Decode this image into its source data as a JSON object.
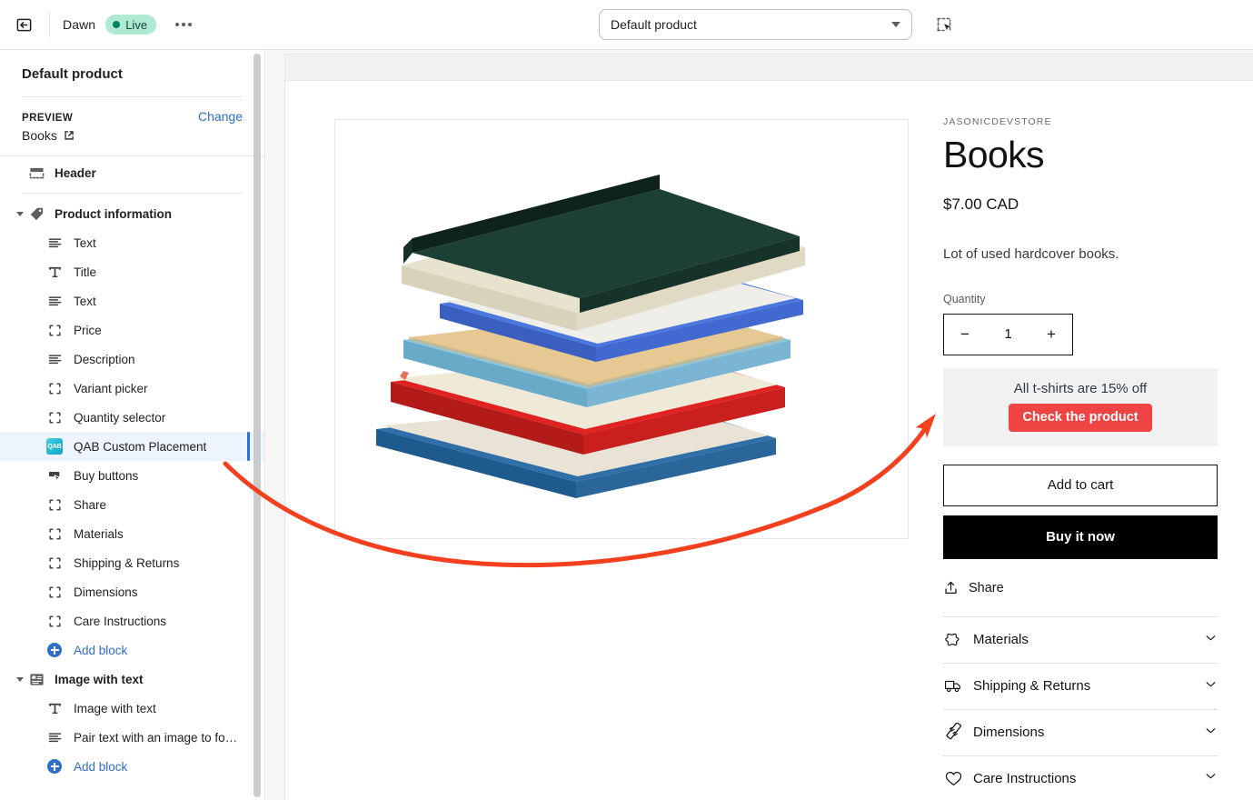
{
  "topbar": {
    "back_icon": "back-arrow-icon",
    "theme_name": "Dawn",
    "status_badge": "Live",
    "more_icon": "ellipsis-icon",
    "template_select": "Default product",
    "inspect_icon": "inspector-select-icon"
  },
  "sidebar": {
    "panel_title": "Default product",
    "preview_label": "PREVIEW",
    "change_link": "Change",
    "preview_value": "Books",
    "external_icon": "external-link-icon",
    "sections": [
      {
        "name": "Header",
        "icon": "header-block-icon",
        "collapsible": false,
        "blocks": []
      },
      {
        "name": "Product information",
        "icon": "tag-icon",
        "collapsible": true,
        "blocks": [
          {
            "label": "Text",
            "icon": "text-lines-icon",
            "selected": false
          },
          {
            "label": "Title",
            "icon": "text-t-icon",
            "selected": false
          },
          {
            "label": "Text",
            "icon": "text-lines-icon",
            "selected": false
          },
          {
            "label": "Price",
            "icon": "brackets-icon",
            "selected": false
          },
          {
            "label": "Description",
            "icon": "text-lines-icon",
            "selected": false
          },
          {
            "label": "Variant picker",
            "icon": "brackets-icon",
            "selected": false
          },
          {
            "label": "Quantity selector",
            "icon": "brackets-icon",
            "selected": false
          },
          {
            "label": "QAB Custom Placement",
            "icon": "qab-app-icon",
            "selected": true
          },
          {
            "label": "Buy buttons",
            "icon": "buy-button-icon",
            "selected": false
          },
          {
            "label": "Share",
            "icon": "brackets-icon",
            "selected": false
          },
          {
            "label": "Materials",
            "icon": "brackets-icon",
            "selected": false
          },
          {
            "label": "Shipping & Returns",
            "icon": "brackets-icon",
            "selected": false
          },
          {
            "label": "Dimensions",
            "icon": "brackets-icon",
            "selected": false
          },
          {
            "label": "Care Instructions",
            "icon": "brackets-icon",
            "selected": false
          }
        ],
        "add_block": "Add block"
      },
      {
        "name": "Image with text",
        "icon": "image-with-text-icon",
        "collapsible": true,
        "blocks": [
          {
            "label": "Image with text",
            "icon": "text-t-icon",
            "selected": false
          },
          {
            "label": "Pair text with an image to fo…",
            "icon": "text-lines-icon",
            "selected": false
          }
        ],
        "add_block": "Add block"
      }
    ]
  },
  "preview": {
    "product_media_alt": "stack-of-hardcover-books",
    "vendor": "JASONICDEVSTORE",
    "title": "Books",
    "price": "$7.00 CAD",
    "description": "Lot of used hardcover books.",
    "quantity_label": "Quantity",
    "quantity_decrement": "−",
    "quantity_value": "1",
    "quantity_increment": "+",
    "promo": {
      "text": "All t-shirts are 15% off",
      "button": "Check the product",
      "button_color": "#ef4444",
      "background": "#f1f1f1"
    },
    "add_to_cart": "Add to cart",
    "buy_it_now": "Buy it now",
    "share": "Share",
    "share_icon": "share-upload-icon",
    "accordions": [
      {
        "label": "Materials",
        "icon": "hide-leather-icon",
        "chevron": "chevron-down-icon"
      },
      {
        "label": "Shipping & Returns",
        "icon": "truck-icon",
        "chevron": "chevron-down-icon"
      },
      {
        "label": "Dimensions",
        "icon": "ruler-icon",
        "chevron": "chevron-down-icon"
      },
      {
        "label": "Care Instructions",
        "icon": "heart-icon",
        "chevron": "chevron-down-icon"
      }
    ]
  },
  "annotation": {
    "arrow_color": "#f5401f",
    "points_from": "QAB Custom Placement",
    "points_to": "promo-banner"
  }
}
